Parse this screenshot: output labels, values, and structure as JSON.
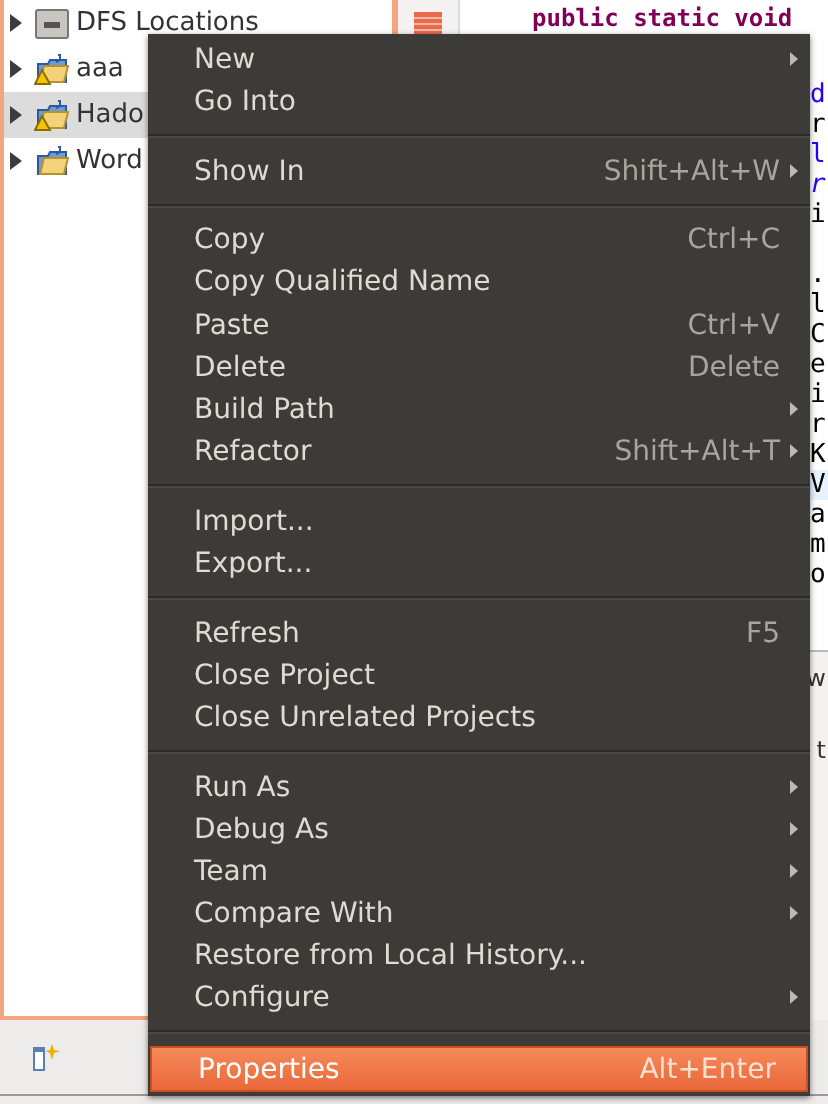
{
  "project_tree": {
    "items": [
      {
        "label": "DFS Locations",
        "kind": "dfs",
        "selected": false
      },
      {
        "label": "aaa",
        "kind": "project",
        "warning": true,
        "selected": false
      },
      {
        "label": "Hado",
        "kind": "project",
        "warning": true,
        "selected": true
      },
      {
        "label": "Word",
        "kind": "project",
        "warning": false,
        "selected": false
      }
    ]
  },
  "editor": {
    "lines": [
      {
        "text": "public static void",
        "kind": "keyword"
      }
    ],
    "edge_blocks": [
      [
        {
          "text": "d",
          "kind": "type"
        },
        {
          "text": "r",
          "kind": "plain"
        },
        {
          "text": "l",
          "kind": "type"
        },
        {
          "text": "r",
          "kind": "italic"
        },
        {
          "text": "i",
          "kind": "plain"
        }
      ],
      [
        {
          "text": ".",
          "kind": "plain"
        },
        {
          "text": "l",
          "kind": "plain"
        },
        {
          "text": "C",
          "kind": "plain"
        },
        {
          "text": "e",
          "kind": "plain"
        },
        {
          "text": "i",
          "kind": "plain"
        },
        {
          "text": "r",
          "kind": "plain"
        },
        {
          "text": "K",
          "kind": "plain"
        },
        {
          "text": "V",
          "kind": "highlight"
        },
        {
          "text": "a",
          "kind": "plain"
        },
        {
          "text": "m",
          "kind": "plain"
        },
        {
          "text": "o",
          "kind": "plain"
        }
      ]
    ]
  },
  "bottom_panel": {
    "tab": "w",
    "line": "t"
  },
  "context_menu": {
    "groups": [
      [
        {
          "label": "New",
          "submenu": true,
          "selected": false
        },
        {
          "label": "Go Into",
          "submenu": false,
          "selected": false
        }
      ],
      [
        {
          "label": "Show In",
          "shortcut": "Shift+Alt+W",
          "submenu": true,
          "selected": false
        }
      ],
      [
        {
          "label": "Copy",
          "shortcut": "Ctrl+C",
          "submenu": false,
          "selected": false
        },
        {
          "label": "Copy Qualified Name",
          "submenu": false,
          "selected": false
        },
        {
          "label": "Paste",
          "shortcut": "Ctrl+V",
          "submenu": false,
          "selected": false
        },
        {
          "label": "Delete",
          "shortcut": "Delete",
          "submenu": false,
          "selected": false
        },
        {
          "label": "Build Path",
          "submenu": true,
          "selected": false
        },
        {
          "label": "Refactor",
          "shortcut": "Shift+Alt+T",
          "submenu": true,
          "selected": false
        }
      ],
      [
        {
          "label": "Import...",
          "submenu": false,
          "selected": false
        },
        {
          "label": "Export...",
          "submenu": false,
          "selected": false
        }
      ],
      [
        {
          "label": "Refresh",
          "shortcut": "F5",
          "submenu": false,
          "selected": false
        },
        {
          "label": "Close Project",
          "submenu": false,
          "selected": false
        },
        {
          "label": "Close Unrelated Projects",
          "submenu": false,
          "selected": false
        }
      ],
      [
        {
          "label": "Run As",
          "submenu": true,
          "selected": false
        },
        {
          "label": "Debug As",
          "submenu": true,
          "selected": false
        },
        {
          "label": "Team",
          "submenu": true,
          "selected": false
        },
        {
          "label": "Compare With",
          "submenu": true,
          "selected": false
        },
        {
          "label": "Restore from Local History...",
          "submenu": false,
          "selected": false
        },
        {
          "label": "Configure",
          "submenu": true,
          "selected": false
        }
      ],
      [
        {
          "label": "Properties",
          "shortcut": "Alt+Enter",
          "submenu": false,
          "selected": true
        }
      ]
    ]
  }
}
